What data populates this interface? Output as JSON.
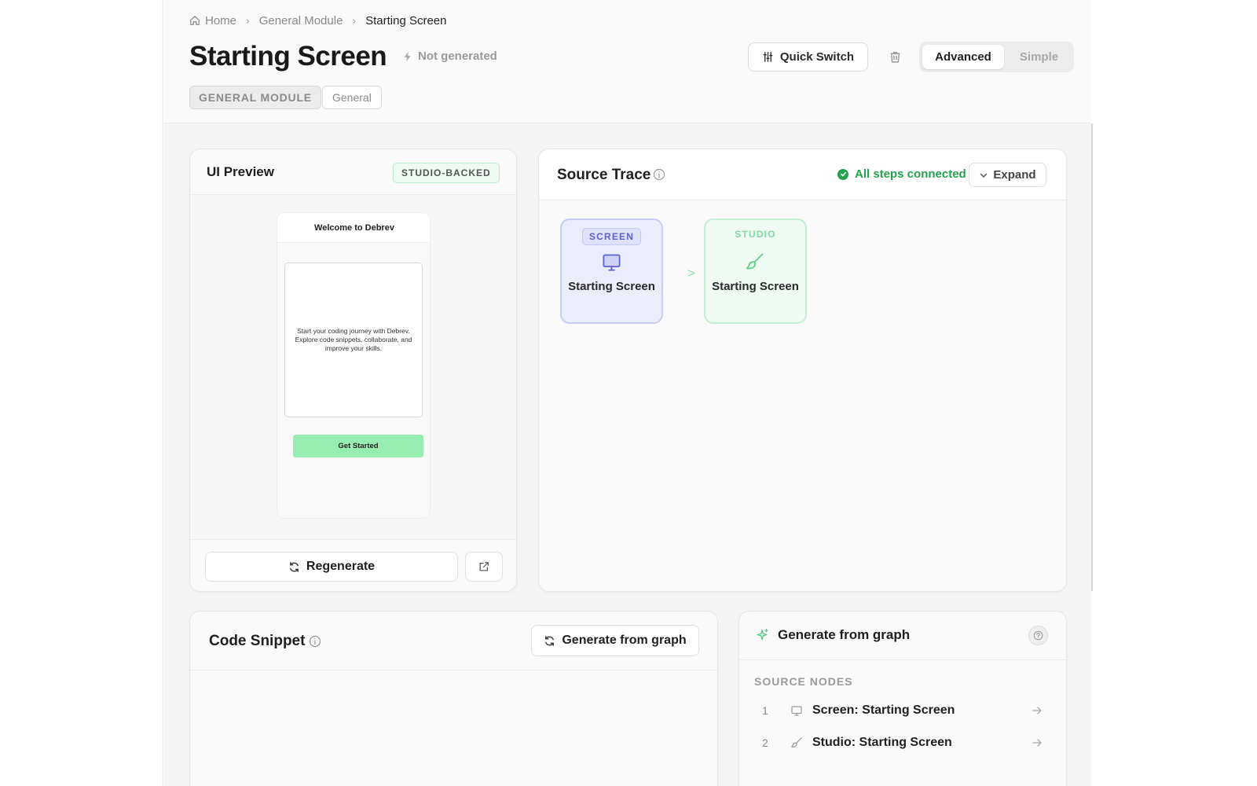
{
  "breadcrumb": {
    "home": "Home",
    "module": "General Module",
    "current": "Starting Screen"
  },
  "header": {
    "title": "Starting Screen",
    "status": "Not generated",
    "tag_module": "GENERAL MODULE",
    "tag_category": "General",
    "quick_switch_label": "Quick Switch",
    "mode_advanced": "Advanced",
    "mode_simple": "Simple",
    "active_mode": "Advanced"
  },
  "ui_preview": {
    "title": "UI Preview",
    "badge": "STUDIO-BACKED",
    "phone": {
      "header": "Welcome to Debrev",
      "body": "Start your coding journey with Debrev. Explore code snippets, collaborate, and improve your skills.",
      "button": "Get Started"
    },
    "regenerate_label": "Regenerate"
  },
  "source_trace": {
    "title": "Source Trace",
    "status": "All steps connected",
    "expand_label": "Expand",
    "nodes": [
      {
        "kind": "SCREEN",
        "name": "Starting Screen",
        "icon": "monitor-icon",
        "color": "#5c63d8"
      },
      {
        "kind": "STUDIO",
        "name": "Starting Screen",
        "icon": "brush-icon",
        "color": "#7fd9a0"
      }
    ],
    "arrow": ">"
  },
  "code_snippet": {
    "title": "Code Snippet",
    "generate_label": "Generate from graph"
  },
  "generate_panel": {
    "title": "Generate from graph",
    "subtitle": "SOURCE NODES",
    "sources": [
      {
        "num": "1",
        "label": "Screen: Starting Screen",
        "icon": "monitor-icon"
      },
      {
        "num": "2",
        "label": "Studio: Starting Screen",
        "icon": "brush-icon"
      }
    ]
  },
  "colors": {
    "accent_green": "#24a34d",
    "cta_green": "#97ecb2",
    "screen_purple": "#5c63d8"
  }
}
